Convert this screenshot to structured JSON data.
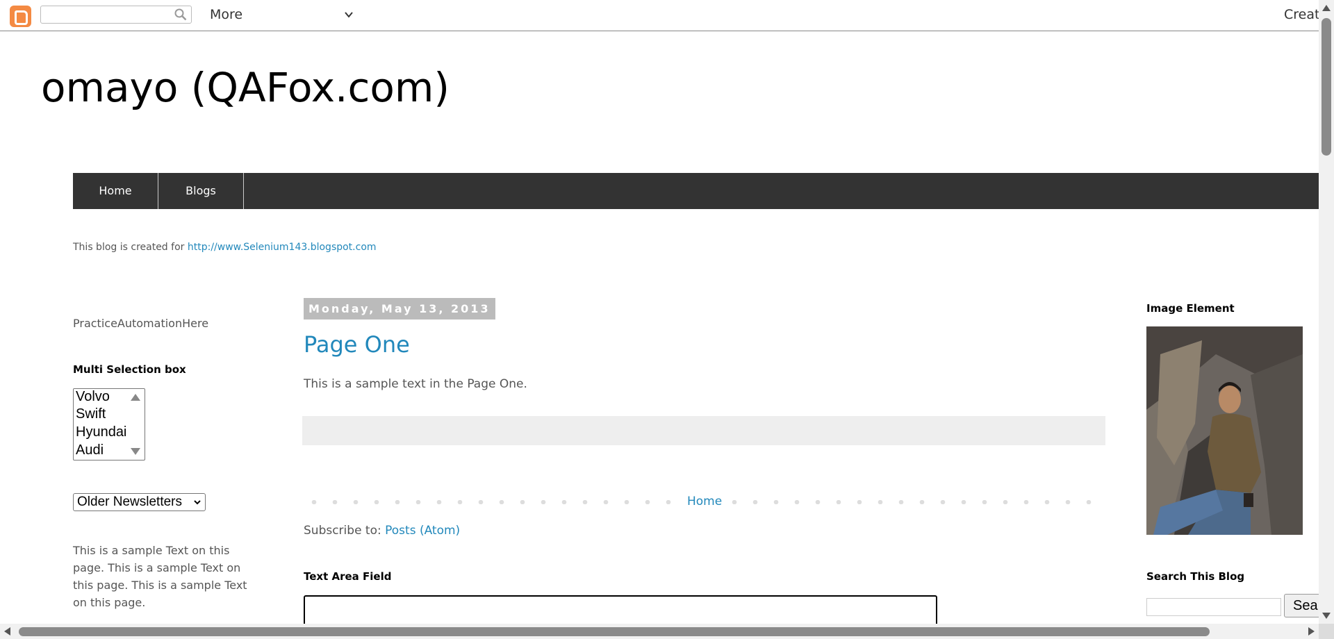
{
  "navbar": {
    "search_placeholder": "",
    "more_label": "More",
    "create_label": "Creat",
    "icons": [
      "blogger-logo-icon",
      "search-icon",
      "chevron-down-icon"
    ]
  },
  "header": {
    "title": "omayo (QAFox.com)"
  },
  "tabs": [
    {
      "label": "Home"
    },
    {
      "label": "Blogs"
    }
  ],
  "description": {
    "text": "This blog is created for ",
    "link": "http://www.Selenium143.blogspot.com"
  },
  "left_sidebar": {
    "practice_text": "PracticeAutomationHere",
    "multiselect_heading": "Multi Selection box",
    "multiselect_options": [
      "Volvo",
      "Swift",
      "Hyundai",
      "Audi"
    ],
    "dropdown_selected": "Older Newsletters",
    "sample_text": "This is a sample Text on this page. This is a sample Text on this page. This is a sample Text on this page."
  },
  "main": {
    "date_header": "Monday, May 13, 2013",
    "post_title": "Page One",
    "post_body": "This is a sample text in the Page One.",
    "pager_home": "Home",
    "subscribe_label": "Subscribe to: ",
    "subscribe_link": "Posts (Atom)",
    "textarea_heading": "Text Area Field"
  },
  "right_sidebar": {
    "image_heading": "Image Element",
    "search_heading": "Search This Blog",
    "search_button": "Search"
  },
  "colors": {
    "link": "#2288bb",
    "tab_bar": "#333333",
    "date_bg": "#bbbbbb",
    "blogger_orange": "#f48a43"
  }
}
